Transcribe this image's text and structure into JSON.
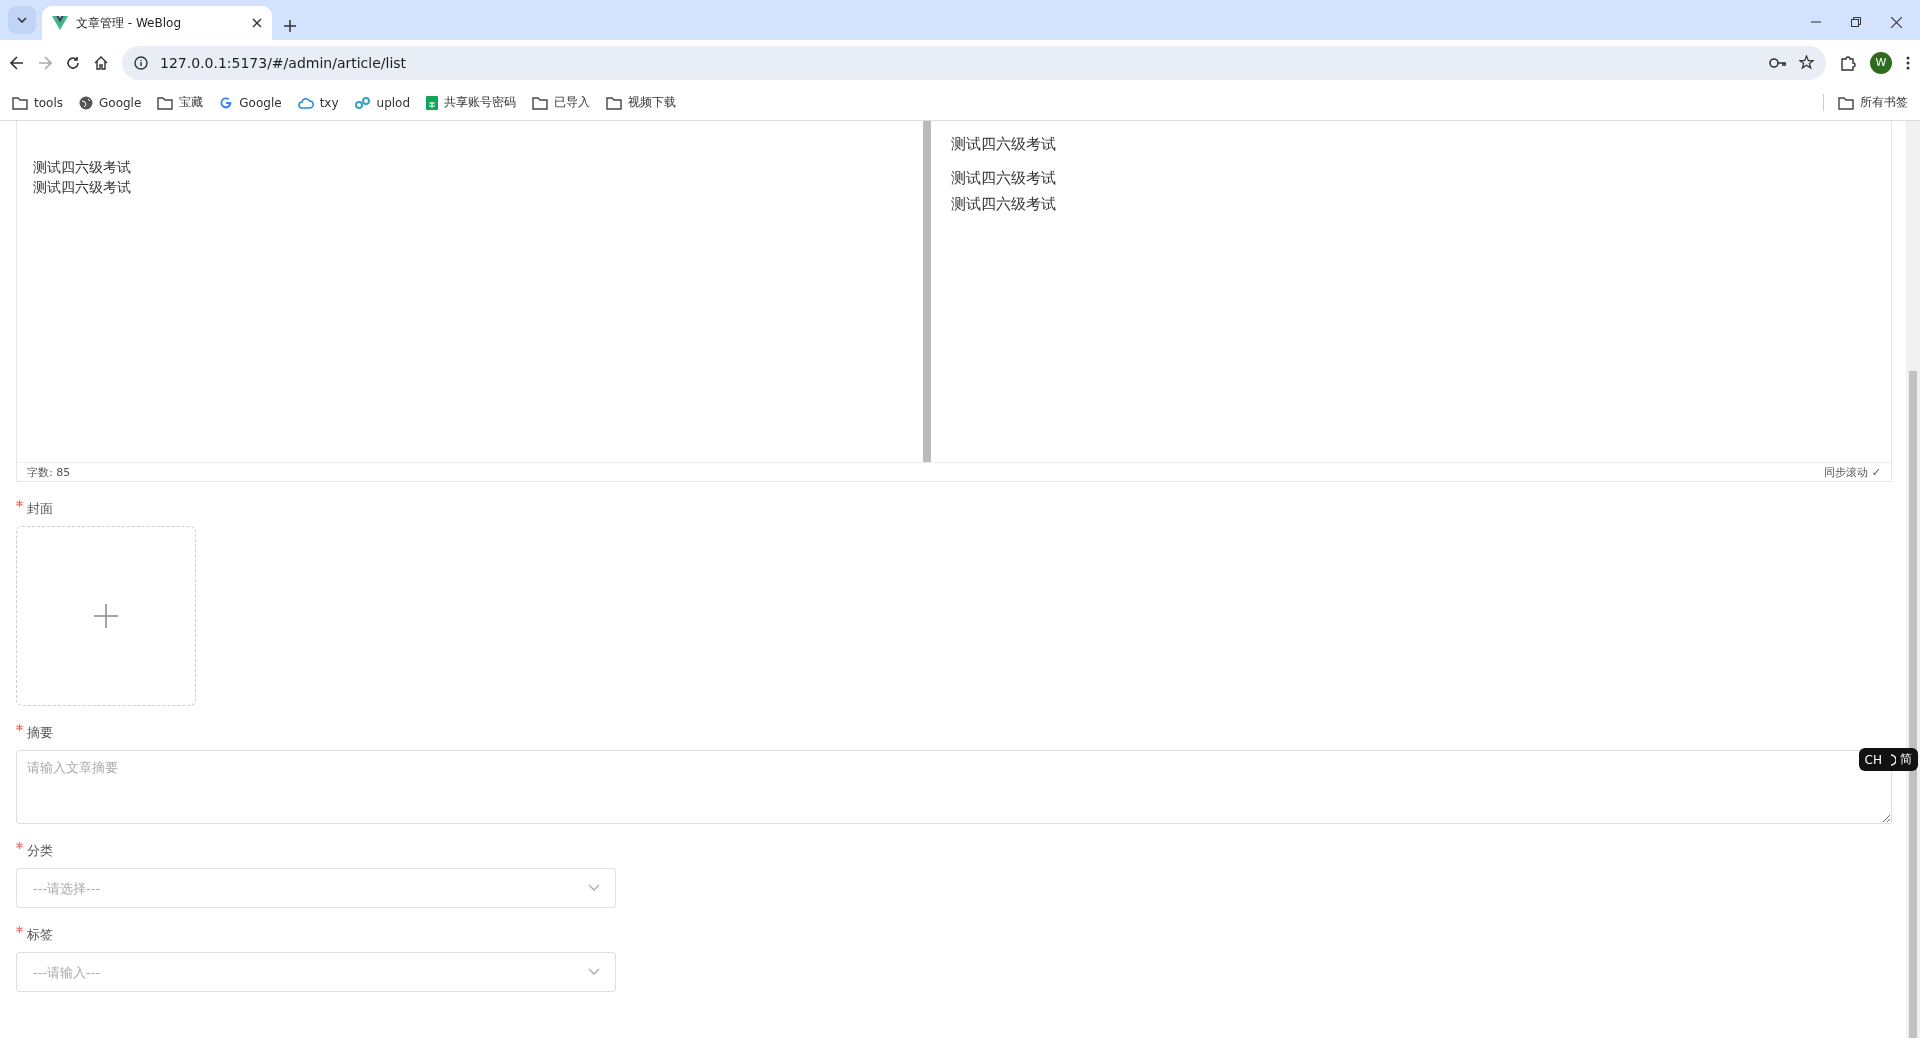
{
  "browser": {
    "tab_title": "文章管理 - WeBlog",
    "url": "127.0.0.1:5173/#/admin/article/list",
    "profile_initial": "W",
    "bookmarks": [
      {
        "kind": "folder",
        "label": "tools"
      },
      {
        "kind": "globe",
        "label": "Google"
      },
      {
        "kind": "folder",
        "label": "宝藏"
      },
      {
        "kind": "g",
        "label": "Google"
      },
      {
        "kind": "cloud",
        "label": "txy"
      },
      {
        "kind": "link",
        "label": "uplod"
      },
      {
        "kind": "sheet",
        "label": "共享账号密码"
      },
      {
        "kind": "folder",
        "label": "已导入"
      },
      {
        "kind": "folder",
        "label": "视频下载"
      }
    ],
    "all_bookmarks": "所有书签"
  },
  "editor": {
    "source_lines": [
      "测试四六级考试",
      "测试四六级考试"
    ],
    "preview_lines": [
      "测试四六级考试",
      "测试四六级考试",
      "测试四六级考试"
    ],
    "word_count": "字数: 85",
    "sync_scroll": "同步滚动 ✓"
  },
  "form": {
    "cover": {
      "label": "封面",
      "required": true
    },
    "summary": {
      "label": "摘要",
      "required": true,
      "placeholder": "请输入文章摘要"
    },
    "category": {
      "label": "分类",
      "required": true,
      "placeholder": "---请选择---"
    },
    "tags": {
      "label": "标签",
      "required": true,
      "placeholder": "---请输入---"
    }
  },
  "ime_indicator": {
    "lang": "CH",
    "mode": "简"
  }
}
